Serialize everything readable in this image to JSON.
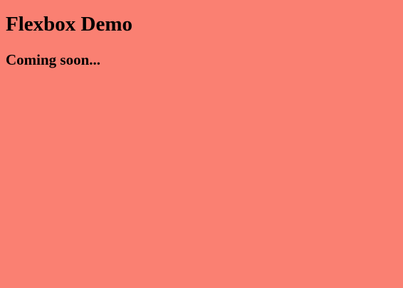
{
  "page": {
    "title": "Flexbox Demo",
    "subtitle": "Coming soon...",
    "background_color": "#fa8072",
    "text_color": "#000000"
  }
}
